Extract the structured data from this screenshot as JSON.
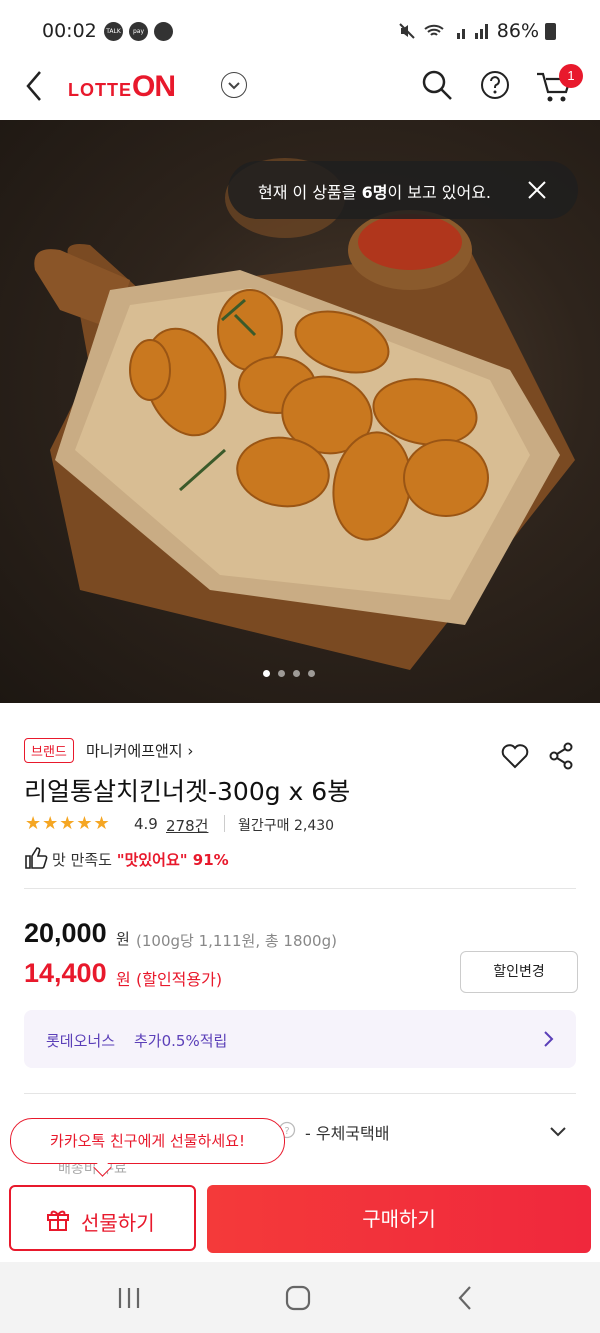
{
  "status_bar": {
    "time": "00:02",
    "notification_icons": [
      "TALK",
      "pay"
    ],
    "battery": "86%"
  },
  "header": {
    "logo_prefix": "LOTTE",
    "logo_suffix": "ON",
    "cart_count": "1",
    "accent": "#e8192c"
  },
  "hero": {
    "toast_prefix": "현재 이 상품을 ",
    "toast_count": "6명",
    "toast_suffix": "이 보고 있어요.",
    "slide_count": 4,
    "active_slide": 1
  },
  "product": {
    "brand_tag": "브랜드",
    "brand_name": "마니커에프앤지",
    "title": "리얼통살치킨너겟-300g x 6봉",
    "stars": "★★★★★",
    "rating": "4.9",
    "review_count": "278건",
    "monthly_sales": "월간구매 2,430",
    "satisfaction_prefix": "맛 만족도 ",
    "satisfaction_value": "\"맛있어요\" 91%"
  },
  "price": {
    "original": "20,000",
    "won": "원",
    "unit_price": "(100g당 1,111원, 총 1800g)",
    "sale": "14,400",
    "sale_label": "(할인적용가)",
    "discount_button": "할인변경"
  },
  "points": {
    "program": "롯데오너스",
    "benefit": "추가0.5%적립"
  },
  "shipping": {
    "label": "배송",
    "method": "- 우체국택배",
    "sub": "배송비 무료"
  },
  "gift_bubble": "카카오톡 친구에게 선물하세요!",
  "actions": {
    "gift": "선물하기",
    "buy": "구매하기"
  }
}
